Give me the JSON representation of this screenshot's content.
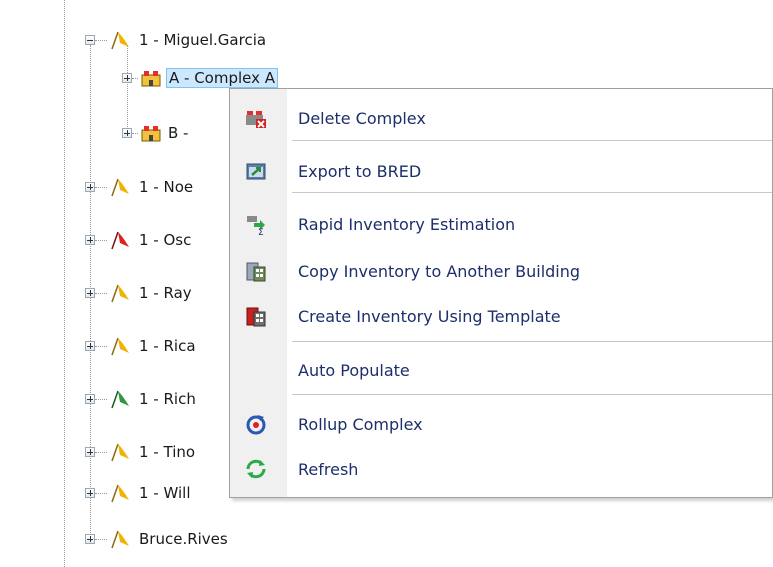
{
  "tree": {
    "nodes": [
      {
        "label": "1 - Miguel.Garcia",
        "flag_color": "#f0b400",
        "expanded": true
      },
      {
        "label": "A - Complex A",
        "type": "complex",
        "selected": true
      },
      {
        "label": "B - ",
        "type": "complex"
      },
      {
        "label": "1 - Noe",
        "flag_color": "#f0b400"
      },
      {
        "label": "1 - Osc",
        "flag_color": "#e02020"
      },
      {
        "label": "1 - Ray",
        "flag_color": "#f0b400"
      },
      {
        "label": "1 - Rica",
        "flag_color": "#f0b400"
      },
      {
        "label": "1 - Rich",
        "flag_color": "#2a9a3a"
      },
      {
        "label": "1 - Tino",
        "flag_color": "#f0b400"
      },
      {
        "label": "1 - Will",
        "flag_color": "#f0b400"
      },
      {
        "label": "Bruce.Rives",
        "flag_color": "#f0b400"
      }
    ]
  },
  "context_menu": {
    "items": [
      {
        "label": "Delete Complex",
        "icon": "delete-complex-icon"
      },
      {
        "label": "Export to BRED",
        "icon": "export-icon"
      },
      {
        "label": "Rapid Inventory Estimation",
        "icon": "estimate-icon"
      },
      {
        "label": "Copy Inventory to Another Building",
        "icon": "copy-inventory-icon"
      },
      {
        "label": "Create Inventory Using Template",
        "icon": "template-icon"
      },
      {
        "label": "Auto Populate",
        "icon": ""
      },
      {
        "label": "Rollup Complex",
        "icon": "rollup-icon"
      },
      {
        "label": "Refresh",
        "icon": "refresh-icon"
      }
    ]
  },
  "colors": {
    "menu_text": "#1c2e6b",
    "selection_bg": "#cce8ff",
    "flag_yellow": "#f0b400",
    "flag_red": "#e02020",
    "flag_green": "#2a9a3a"
  }
}
